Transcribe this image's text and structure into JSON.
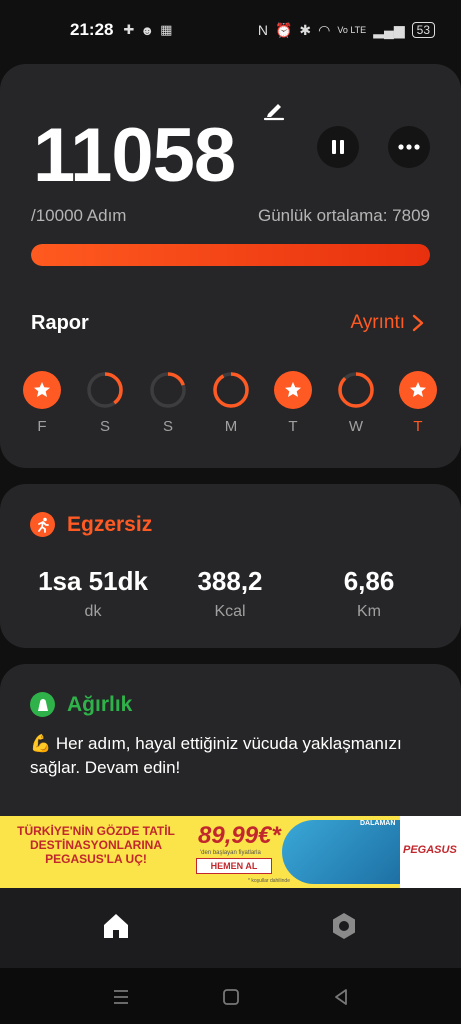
{
  "status_bar": {
    "time": "21:28",
    "battery": "53",
    "left_icons": [
      "plus-badge-icon",
      "app-face-icon",
      "grid-app-icon"
    ],
    "right_icons": [
      "nfc-icon",
      "alarm-icon",
      "bluetooth-icon",
      "wifi-icon",
      "volte-icon",
      "signal-icon"
    ]
  },
  "steps": {
    "value": "11058",
    "goal": "/10000 Adım",
    "daily_average": "Günlük ortalama: 7809",
    "progress_fraction": 1.0
  },
  "report": {
    "title": "Rapor",
    "details_label": "Ayrıntı",
    "days": [
      {
        "label": "F",
        "progress": 1.0,
        "completed": true,
        "today": false
      },
      {
        "label": "S",
        "progress": 0.4,
        "completed": false,
        "today": false
      },
      {
        "label": "S",
        "progress": 0.2,
        "completed": false,
        "today": false
      },
      {
        "label": "M",
        "progress": 0.92,
        "completed": false,
        "today": false
      },
      {
        "label": "T",
        "progress": 1.0,
        "completed": true,
        "today": false
      },
      {
        "label": "W",
        "progress": 0.88,
        "completed": false,
        "today": false
      },
      {
        "label": "T",
        "progress": 1.0,
        "completed": true,
        "today": true
      }
    ]
  },
  "exercise": {
    "title": "Egzersiz",
    "stats": [
      {
        "value": "1sa 51dk",
        "unit": "dk"
      },
      {
        "value": "388,2",
        "unit": "Kcal"
      },
      {
        "value": "6,86",
        "unit": "Km"
      }
    ]
  },
  "weight": {
    "title": "Ağırlık",
    "message": "💪 Her adım, hayal ettiğiniz vücuda yaklaşmanızı sağlar. Devam edin!"
  },
  "ad": {
    "headline": "TÜRKİYE'NİN GÖZDE TATİL DESTİNASYONLARINA PEGASUS'LA UÇ!",
    "price": "89,99€*",
    "price_note": "'den başlayan fiyatlarla",
    "cta": "HEMEN AL",
    "footnote": "* koşullar dahilinde",
    "map_label": "DALAMAN",
    "brand": "PEGASUS"
  },
  "bottom_nav": [
    "home-icon",
    "settings-icon"
  ],
  "system_nav": [
    "menu-icon",
    "home-square-icon",
    "back-icon"
  ],
  "colors": {
    "accent": "#ff5a23",
    "green": "#2fb24a",
    "card": "#262628",
    "background": "#101010"
  }
}
